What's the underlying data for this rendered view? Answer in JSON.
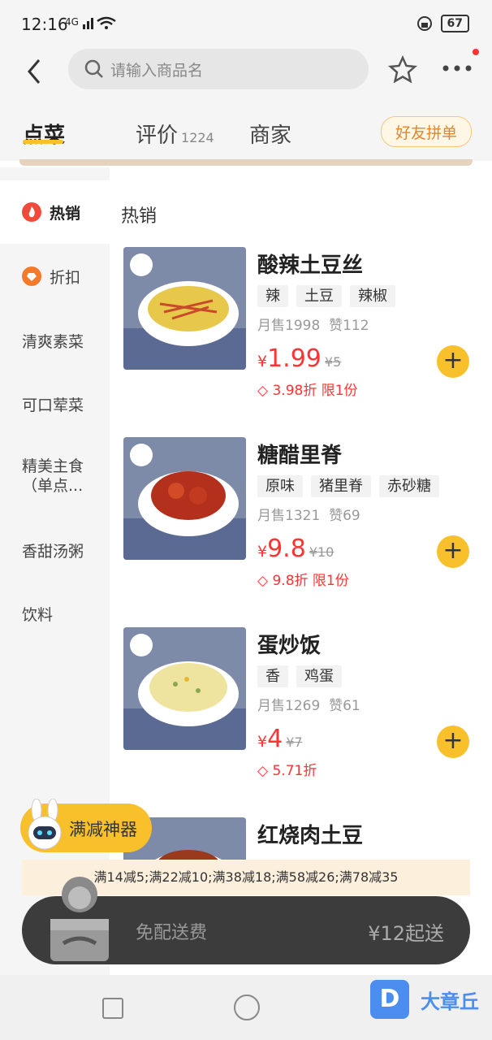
{
  "status": {
    "time": "12:16",
    "network": "4G",
    "battery": "67"
  },
  "search": {
    "placeholder": "请输入商品名"
  },
  "tabs": {
    "order": "点菜",
    "reviews": "评价",
    "review_count": "1224",
    "merchant": "商家",
    "friend_group": "好友拼单"
  },
  "sidebar": {
    "items": [
      {
        "label": "热销",
        "icon": "fire-icon"
      },
      {
        "label": "折扣",
        "icon": "discount-icon"
      },
      {
        "label": "清爽素菜"
      },
      {
        "label": "可口荤菜"
      },
      {
        "label": "精美主食（单点..."
      },
      {
        "label": "香甜汤粥"
      },
      {
        "label": "饮料"
      }
    ]
  },
  "section_title": "热销",
  "dishes": [
    {
      "name": "酸辣土豆丝",
      "tags": [
        "辣",
        "土豆",
        "辣椒"
      ],
      "sales": "月售1998",
      "likes": "赞112",
      "price": "1.99",
      "orig": "¥5",
      "promo": "3.98折 限1份"
    },
    {
      "name": "糖醋里脊",
      "tags": [
        "原味",
        "猪里脊",
        "赤砂糖"
      ],
      "sales": "月售1321",
      "likes": "赞69",
      "price": "9.8",
      "orig": "¥10",
      "promo": "9.8折 限1份"
    },
    {
      "name": "蛋炒饭",
      "tags": [
        "香",
        "鸡蛋"
      ],
      "sales": "月售1269",
      "likes": "赞61",
      "price": "4",
      "orig": "¥7",
      "promo": "5.71折"
    },
    {
      "name": "红烧肉土豆",
      "tags": [],
      "sales": "",
      "likes": "",
      "price": "",
      "orig": "",
      "promo": ""
    }
  ],
  "mj_badge": "满减神器",
  "promo_bar": "满14减5;满22减10;满38减18;满58减26;满78减35",
  "cart": {
    "free_delivery": "免配送费",
    "min_order": "¥12起送"
  },
  "watermark": {
    "logo": "D",
    "text": "大章丘"
  },
  "colors": {
    "accent": "#f8c02a",
    "price": "#ff3333"
  }
}
